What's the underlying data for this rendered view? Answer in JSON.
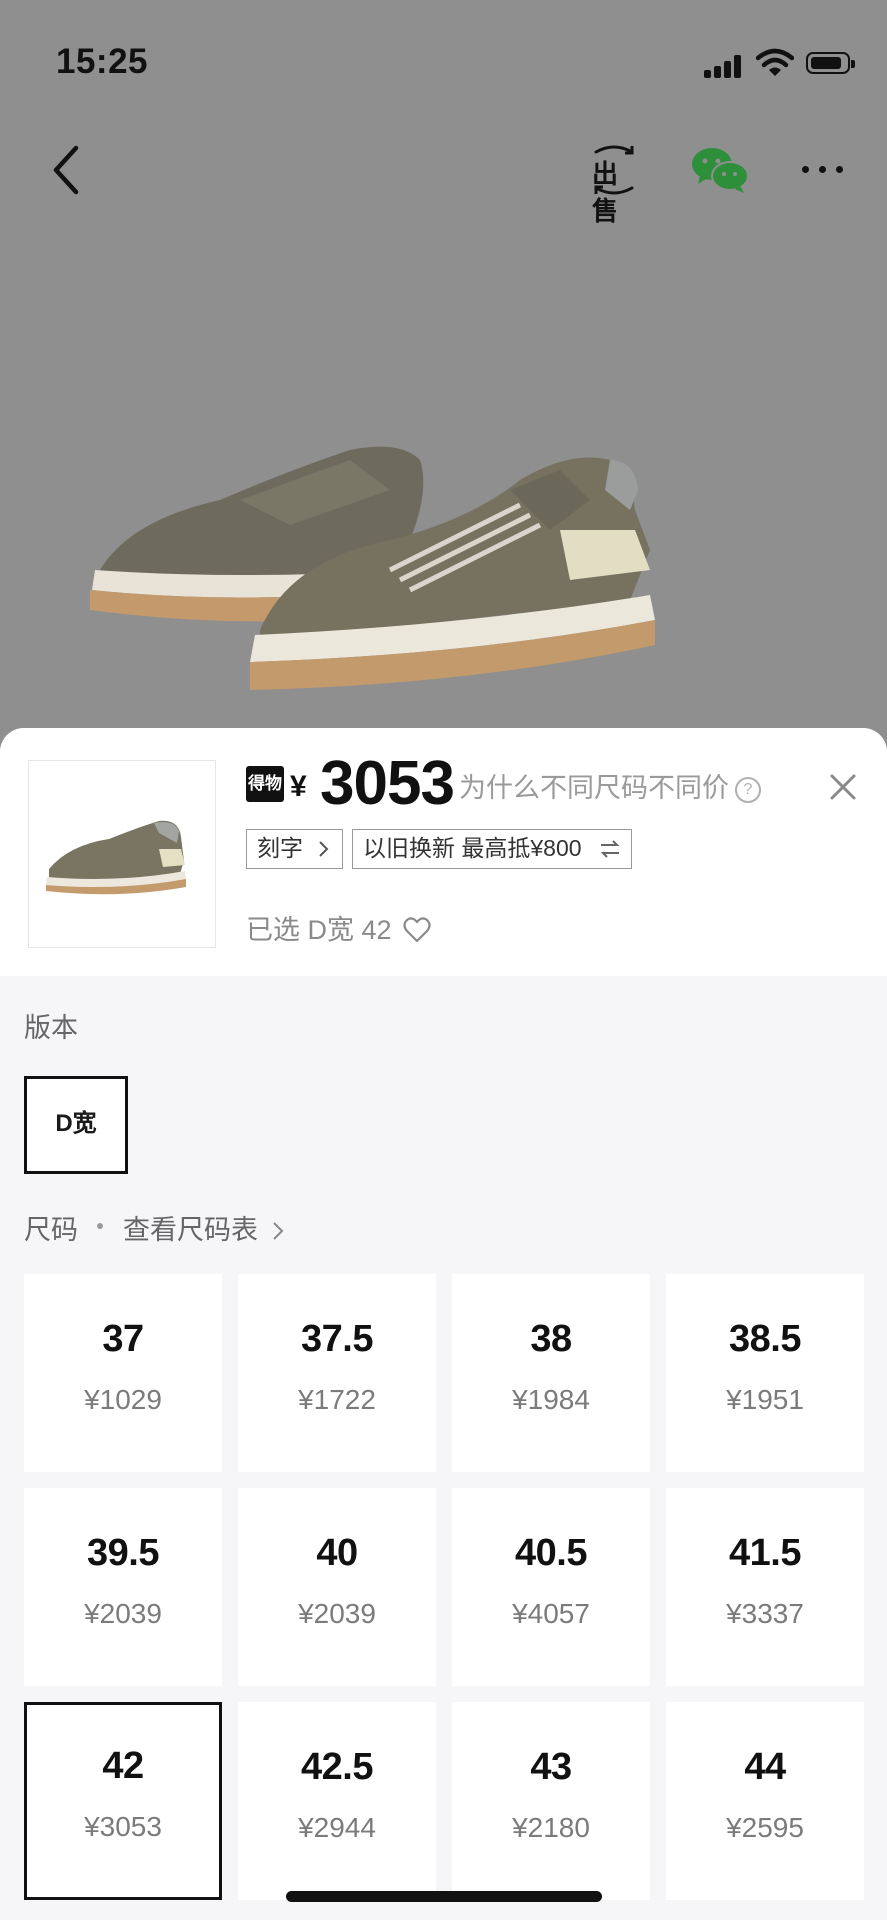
{
  "status_bar": {
    "time": "15:25"
  },
  "top_nav": {
    "sell_label": "出售"
  },
  "product": {
    "platform_logo": "得物",
    "currency": "¥",
    "price": "3053",
    "why_price_text": "为什么不同尺码不同价",
    "selected_text": "已选 D宽 42"
  },
  "tags": {
    "engraving": "刻字",
    "trade_in": "以旧换新 最高抵¥800"
  },
  "version": {
    "label": "版本",
    "options": [
      "D宽"
    ]
  },
  "size": {
    "label": "尺码",
    "chart_link": "查看尺码表",
    "options": [
      {
        "size": "37",
        "price": "¥1029"
      },
      {
        "size": "37.5",
        "price": "¥1722"
      },
      {
        "size": "38",
        "price": "¥1984"
      },
      {
        "size": "38.5",
        "price": "¥1951"
      },
      {
        "size": "39.5",
        "price": "¥2039"
      },
      {
        "size": "40",
        "price": "¥2039"
      },
      {
        "size": "40.5",
        "price": "¥4057"
      },
      {
        "size": "41.5",
        "price": "¥3337"
      },
      {
        "size": "42",
        "price": "¥3053"
      },
      {
        "size": "42.5",
        "price": "¥2944"
      },
      {
        "size": "43",
        "price": "¥2180"
      },
      {
        "size": "44",
        "price": "¥2595"
      }
    ]
  },
  "icons": [
    "back-icon",
    "sell-icon",
    "wechat-icon",
    "more-icon",
    "question-icon",
    "close-icon",
    "chevron-right-icon",
    "swap-icon",
    "heart-icon"
  ],
  "colors": {
    "overlay": "#8f8f8f",
    "sheet_bg": "#f6f6f9",
    "accent": "#111111"
  }
}
